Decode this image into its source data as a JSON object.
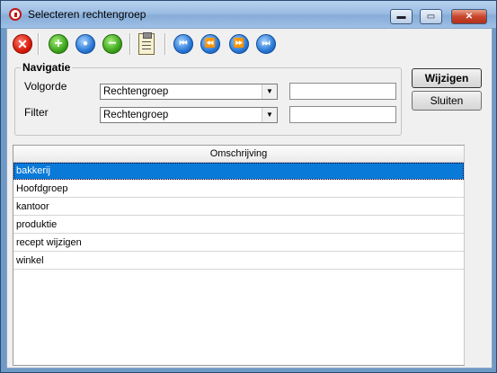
{
  "window": {
    "title": "Selecteren rechtengroep",
    "caption_buttons": {
      "minimize": "▬",
      "maximize": "▭",
      "close": "✕"
    }
  },
  "toolbar": {
    "buttons": [
      {
        "name": "delete-icon",
        "glyph": "✕"
      },
      {
        "name": "add-icon",
        "glyph": "+"
      },
      {
        "name": "search-icon",
        "glyph": "●"
      },
      {
        "name": "remove-icon",
        "glyph": "−"
      },
      {
        "name": "clipboard-icon",
        "glyph": ""
      },
      {
        "name": "first-record-icon",
        "glyph": "⏮"
      },
      {
        "name": "previous-record-icon",
        "glyph": "⏪"
      },
      {
        "name": "next-record-icon",
        "glyph": "⏩"
      },
      {
        "name": "last-record-icon",
        "glyph": "⏭"
      }
    ]
  },
  "navigatie": {
    "title": "Navigatie",
    "volgorde": {
      "label": "Volgorde",
      "value": "Rechtengroep",
      "text": ""
    },
    "filter": {
      "label": "Filter",
      "value": "Rechtengroep",
      "text": ""
    }
  },
  "actions": {
    "wijzigen": "Wijzigen",
    "sluiten": "Sluiten"
  },
  "grid": {
    "column": "Omschrijving",
    "rows": [
      "bakkerij",
      "Hoofdgroep",
      "kantoor",
      "produktie",
      "recept wijzigen",
      "winkel"
    ],
    "selected_index": 0
  },
  "colors": {
    "selection": "#0a7ad8",
    "title_bar": "#9cbde3"
  }
}
